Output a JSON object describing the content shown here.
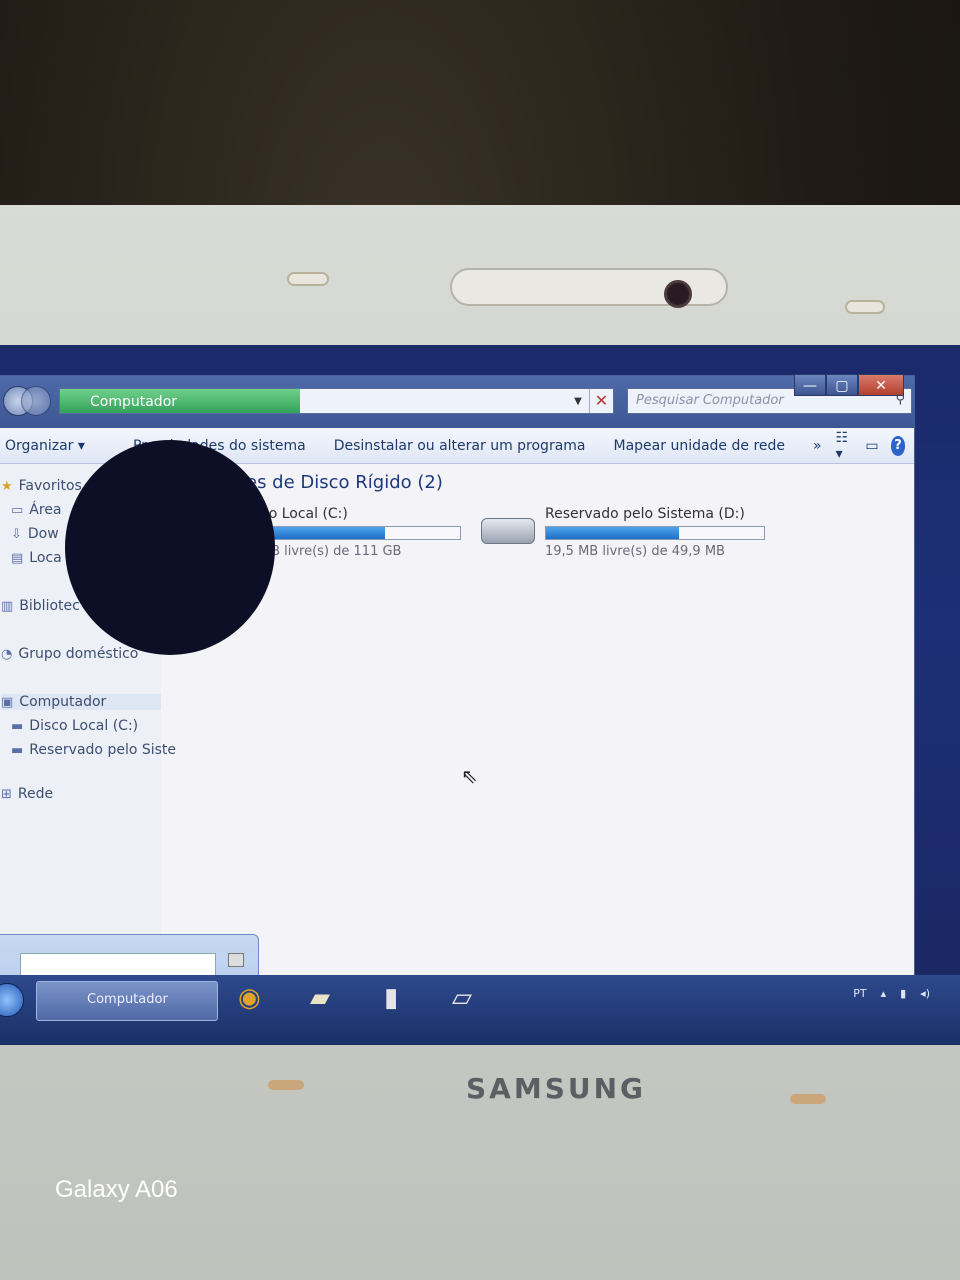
{
  "window": {
    "address": "Computador",
    "search_placeholder": "Pesquisar Computador"
  },
  "toolbar": {
    "organize": "Organizar",
    "system_properties": "Propriedades do sistema",
    "uninstall": "Desinstalar ou alterar um programa",
    "map_drive": "Mapear unidade de rede",
    "more": "»",
    "help": "?"
  },
  "nav": {
    "favorites": "Favoritos",
    "desktop": "Área",
    "downloads": "Dow",
    "local": "Loca",
    "libraries": "Bibliotec",
    "homegroup": "Grupo doméstico",
    "computer": "Computador",
    "disk_c": "Disco Local (C:)",
    "disk_d": "Reservado pelo Siste",
    "network": "Rede"
  },
  "main": {
    "group_title": "es de Disco Rígido (2)",
    "drives": [
      {
        "name": "co Local (C:)",
        "free": "GB livre(s) de 111 GB",
        "usage": 0.62
      },
      {
        "name": "Reservado pelo Sistema (D:)",
        "free": "19,5 MB livre(s) de 49,9 MB",
        "usage": 0.61
      }
    ]
  },
  "taskbar": {
    "active_window": "Computador",
    "tray_lang": "PT"
  },
  "device": {
    "brand": "SAMSUNG",
    "camera_watermark": "Galaxy A06"
  },
  "colors": {
    "titlebar": "#3d5794",
    "progress_fill": "#1f6fc8",
    "address_crumb": "#34a25a"
  }
}
